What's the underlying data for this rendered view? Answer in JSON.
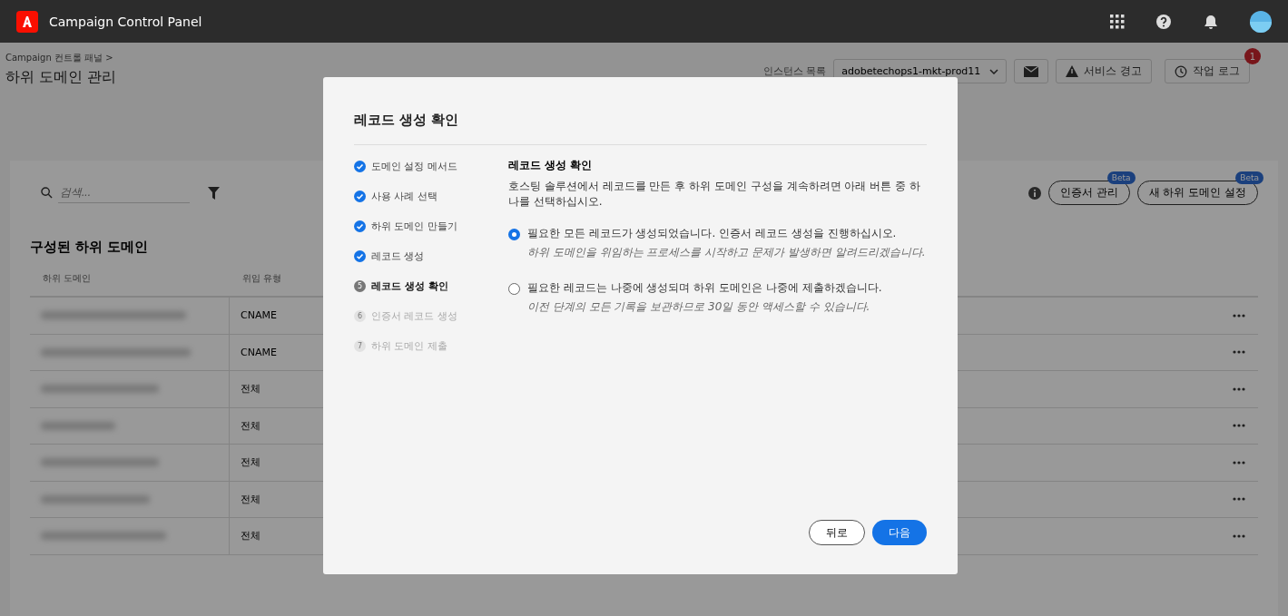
{
  "app": {
    "title": "Campaign Control Panel"
  },
  "breadcrumb": {
    "parent": "Campaign 컨트롤 패널",
    "separator": ">",
    "title": "하위 도메인 관리"
  },
  "toolbar": {
    "instance_label": "인스턴스 목록",
    "instance_value": "adobetechops1-mkt-prod11",
    "alerts_button": "서비스 경고",
    "log_button": "작업 로그",
    "log_badge": "1"
  },
  "search": {
    "placeholder": "검색..."
  },
  "actions": [
    {
      "label": "인증서 관리",
      "badge": "Beta"
    },
    {
      "label": "새 하위 도메인 설정",
      "badge": "Beta"
    }
  ],
  "table": {
    "title": "구성된 하위 도메인",
    "columns": [
      "하위 도메인",
      "위임 유형"
    ],
    "rows": [
      {
        "type": "CNAME"
      },
      {
        "type": "CNAME"
      },
      {
        "type": "전체"
      },
      {
        "type": "전체"
      },
      {
        "type": "전체"
      },
      {
        "type": "전체"
      },
      {
        "type": "전체"
      }
    ]
  },
  "dialog": {
    "title": "레코드 생성 확인",
    "steps": [
      {
        "label": "도메인 설정 메서드",
        "completed": true,
        "selected": false
      },
      {
        "label": "사용 사례 선택",
        "completed": true,
        "selected": false
      },
      {
        "label": "하위 도메인 만들기",
        "completed": true,
        "selected": false
      },
      {
        "label": "레코드 생성",
        "completed": true,
        "selected": false
      },
      {
        "number": "5",
        "label": "레코드 생성 확인",
        "completed": false,
        "selected": true
      },
      {
        "number": "6",
        "label": "인증서 레코드 생성",
        "completed": false,
        "selected": false
      },
      {
        "number": "7",
        "label": "하위 도메인 제출",
        "completed": false,
        "selected": false
      }
    ],
    "heading": "레코드 생성 확인",
    "description": "호스팅 솔루션에서 레코드를 만든 후 하위 도메인 구성을 계속하려면 아래 버튼 중 하나를 선택하십시오.",
    "options": [
      {
        "label": "필요한 모든 레코드가 생성되었습니다. 인증서 레코드 생성을 진행하십시오.",
        "hint": "하위 도메인을 위임하는 프로세스를 시작하고 문제가 발생하면 알려드리겠습니다.",
        "selected": true
      },
      {
        "label": "필요한 레코드는 나중에 생성되며 하위 도메인은 나중에 제출하겠습니다.",
        "hint": "이전 단계의 모든 기록을 보관하므로 30일 동안 액세스할 수 있습니다.",
        "selected": false
      }
    ],
    "back_button": "뒤로",
    "next_button": "다음"
  }
}
